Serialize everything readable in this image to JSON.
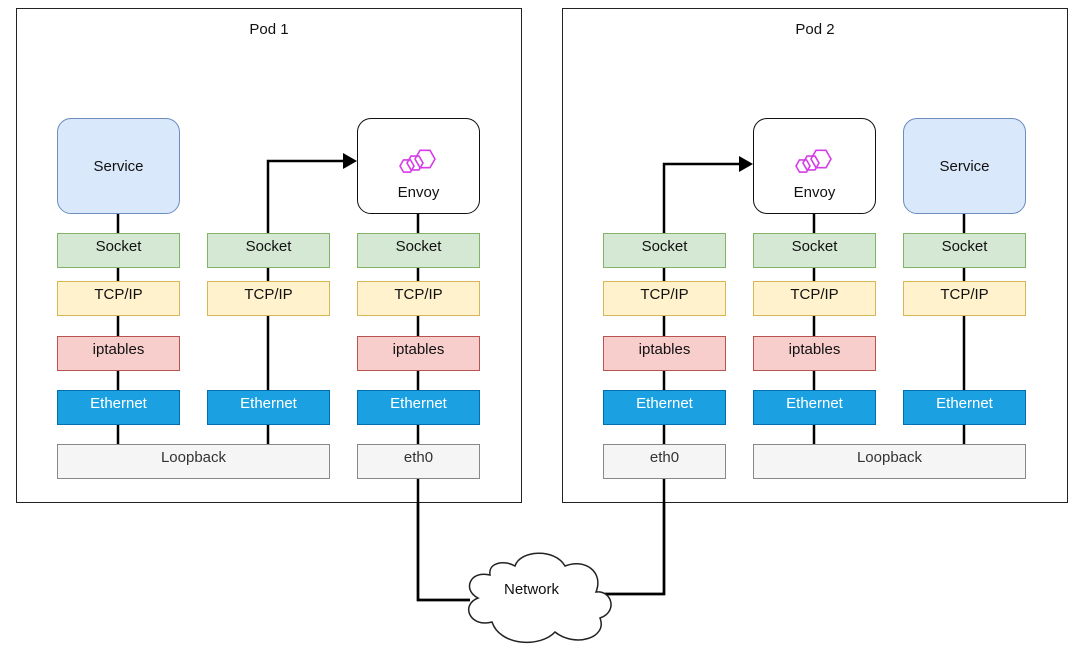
{
  "pods": [
    {
      "title": "Pod 1",
      "columns": [
        {
          "top": {
            "type": "service",
            "label": "Service"
          },
          "layers": [
            "Socket",
            "TCP/IP",
            "iptables",
            "Ethernet"
          ]
        },
        {
          "top": null,
          "layers": [
            "Socket",
            "TCP/IP",
            null,
            "Ethernet"
          ]
        },
        {
          "top": {
            "type": "envoy",
            "label": "Envoy"
          },
          "layers": [
            "Socket",
            "TCP/IP",
            "iptables",
            "Ethernet"
          ]
        }
      ],
      "interfaces": [
        "Loopback",
        "eth0"
      ]
    },
    {
      "title": "Pod 2",
      "columns": [
        {
          "top": null,
          "layers": [
            "Socket",
            "TCP/IP",
            "iptables",
            "Ethernet"
          ]
        },
        {
          "top": {
            "type": "envoy",
            "label": "Envoy"
          },
          "layers": [
            "Socket",
            "TCP/IP",
            "iptables",
            "Ethernet"
          ]
        },
        {
          "top": {
            "type": "service",
            "label": "Service"
          },
          "layers": [
            "Socket",
            "TCP/IP",
            null,
            "Ethernet"
          ]
        }
      ],
      "interfaces": [
        "eth0",
        "Loopback"
      ]
    }
  ],
  "network": {
    "label": "Network",
    "icon": "cloud-icon"
  },
  "envoy_icon": {
    "name": "envoy-hexagons-icon",
    "color": "#d63ce8"
  },
  "colors": {
    "service_fill": "#dae8fc",
    "socket_fill": "#d5e8d4",
    "tcp_fill": "#fff2cc",
    "iptables_fill": "#f8cecc",
    "ethernet_fill": "#1ba1e2",
    "interface_fill": "#f5f5f5"
  }
}
